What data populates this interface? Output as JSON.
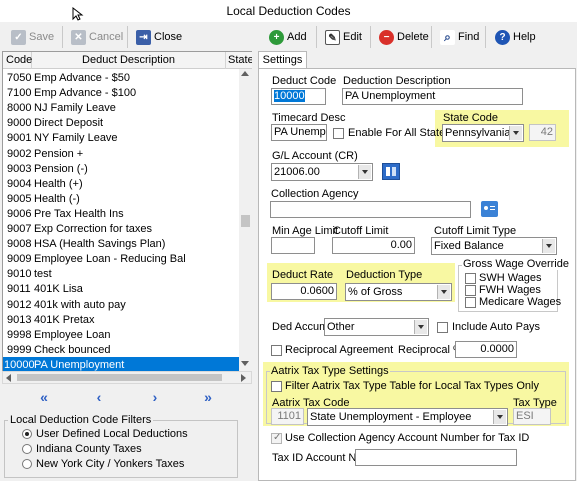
{
  "window": {
    "title": "Local Deduction Codes"
  },
  "left_toolbar": {
    "save": "Save",
    "cancel": "Cancel",
    "close": "Close"
  },
  "right_toolbar": {
    "add": "Add",
    "edit": "Edit",
    "delete": "Delete",
    "find": "Find",
    "help": "Help"
  },
  "list": {
    "headers": {
      "code": "Code",
      "description": "Deduct Description",
      "state": "State"
    },
    "rows": [
      {
        "code": "7050",
        "desc": "Emp Advance - $50"
      },
      {
        "code": "7100",
        "desc": "Emp Advance - $100"
      },
      {
        "code": "8000",
        "desc": "NJ Family Leave"
      },
      {
        "code": "9000",
        "desc": "Direct Deposit"
      },
      {
        "code": "9001",
        "desc": "NY Family Leave"
      },
      {
        "code": "9002",
        "desc": "Pension +"
      },
      {
        "code": "9003",
        "desc": "Pension (-)"
      },
      {
        "code": "9004",
        "desc": "Health (+)"
      },
      {
        "code": "9005",
        "desc": "Health (-)"
      },
      {
        "code": "9006",
        "desc": "Pre Tax Health Ins"
      },
      {
        "code": "9007",
        "desc": "Exp Correction for taxes"
      },
      {
        "code": "9008",
        "desc": "HSA (Health Savings Plan)"
      },
      {
        "code": "9009",
        "desc": "Employee Loan - Reducing Bal"
      },
      {
        "code": "9010",
        "desc": "test"
      },
      {
        "code": "9011",
        "desc": "401K Lisa"
      },
      {
        "code": "9012",
        "desc": "401k with auto pay"
      },
      {
        "code": "9013",
        "desc": "401K Pretax"
      },
      {
        "code": "9998",
        "desc": "Employee Loan"
      },
      {
        "code": "9999",
        "desc": "Check bounced"
      },
      {
        "code": "10000",
        "desc": "PA Unemployment"
      }
    ]
  },
  "nav": {
    "first": "«",
    "prev": "‹",
    "next": "›",
    "last": "»"
  },
  "filters": {
    "title": "Local Deduction Code Filters",
    "options": [
      "User Defined Local Deductions",
      "Indiana County Taxes",
      "New York City / Yonkers Taxes"
    ],
    "selected": "User Defined Local Deductions"
  },
  "form": {
    "tab": "Settings",
    "deduct_code_label": "Deduct Code",
    "deduct_code": "10000",
    "deduction_desc_label": "Deduction Description",
    "deduction_desc": "PA Unemployment",
    "timecard_label": "Timecard Desc",
    "timecard_desc": "PA Unemp",
    "enable_all_states": "Enable For All States",
    "state_code_label": "State Code",
    "state_code": "Pennsylvania",
    "state_num": "42",
    "gl_label": "G/L Account (CR)",
    "gl_account": "21006.00",
    "collection_label": "Collection Agency",
    "collection_value": "",
    "min_age_label": "Min Age Limit",
    "min_age": "",
    "cutoff_label": "Cutoff Limit",
    "cutoff": "0.00",
    "cutoff_type_label": "Cutoff Limit Type",
    "cutoff_type": "Fixed Balance",
    "deduct_rate_label": "Deduct Rate",
    "deduct_rate": "0.0600",
    "deduction_type_label": "Deduction Type",
    "deduction_type": "% of Gross",
    "gross_override_label": "Gross Wage Override",
    "gross_options": [
      "SWH Wages",
      "FWH Wages",
      "Medicare Wages"
    ],
    "ded_accum_label": "Ded Accum",
    "ded_accum": "Other",
    "include_auto_pays": "Include Auto Pays",
    "reciprocal_agreement": "Reciprocal Agreement",
    "reciprocal_pct_label": "Reciprocal %",
    "reciprocal_pct": "0.0000",
    "aatrix_title": "Aatrix Tax Type Settings",
    "filter_aatrix": "Filter Aatrix Tax Type Table for Local Tax Types Only",
    "aatrix_code_label": "Aatrix Tax Code",
    "aatrix_code": "1101",
    "aatrix_desc": "State Unemployment - Employee",
    "tax_type_label": "Tax Type",
    "tax_type": "ESI",
    "use_collection": "Use Collection Agency Account Number for Tax ID",
    "tax_id_label": "Tax ID Account No:",
    "tax_id": ""
  },
  "colors": {
    "selection": "#0078d7",
    "highlight": "#f8f8a2",
    "nav_arrows": "#2e60c4"
  }
}
